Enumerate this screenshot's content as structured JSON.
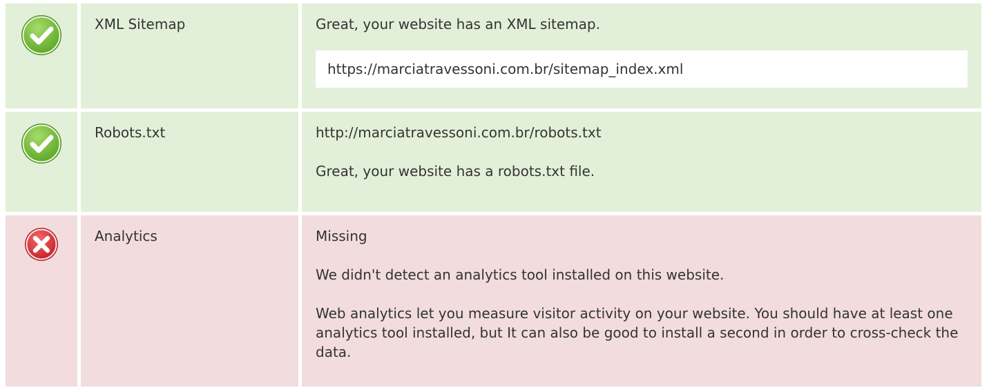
{
  "rows": [
    {
      "status": "pass",
      "icon": "check-circle-icon",
      "label": "XML Sitemap",
      "message": "Great, your website has an XML sitemap.",
      "url": "https://marciatravessoni.com.br/sitemap_index.xml"
    },
    {
      "status": "pass",
      "icon": "check-circle-icon",
      "label": "Robots.txt",
      "url": "http://marciatravessoni.com.br/robots.txt",
      "message": "Great, your website has a robots.txt file."
    },
    {
      "status": "fail",
      "icon": "x-circle-icon",
      "label": "Analytics",
      "value": "Missing",
      "message": "We didn't detect an analytics tool installed on this website.",
      "description": "Web analytics let you measure visitor activity on your website. You should have at least one analytics tool installed, but It can also be good to install a second in order to cross-check the data."
    }
  ],
  "colors": {
    "pass_bg": "#e3f0d9",
    "fail_bg": "#f2dcde",
    "check_green": "#7cc242",
    "cross_red": "#e0393e"
  }
}
